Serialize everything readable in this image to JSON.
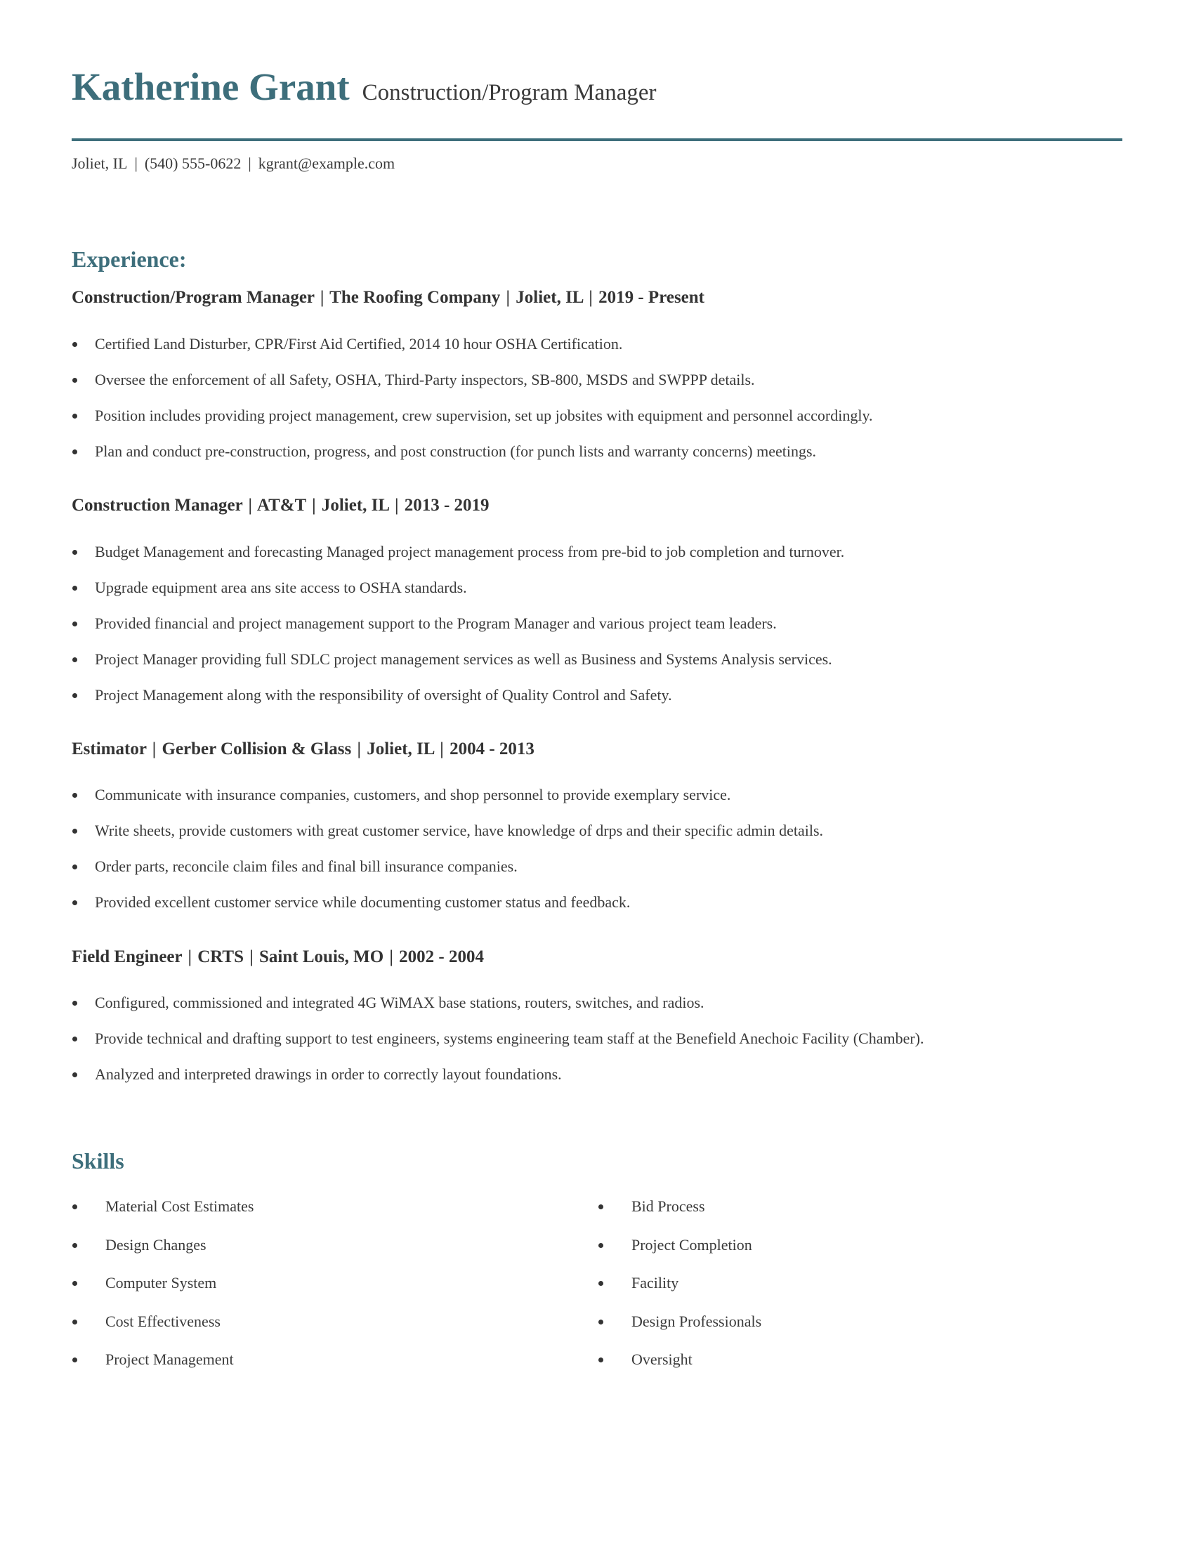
{
  "header": {
    "name": "Katherine Grant",
    "title": "Construction/Program Manager",
    "accent_color": "#3d6e7b"
  },
  "contact": {
    "location": "Joliet, IL",
    "phone": "(540) 555-0622",
    "email": "kgrant@example.com",
    "separator": "|"
  },
  "experience": {
    "heading": "Experience:",
    "jobs": [
      {
        "role": "Construction/Program Manager",
        "company": "The Roofing Company",
        "location": "Joliet, IL",
        "dates": "2019 - Present",
        "bullets": [
          "Certified Land Disturber, CPR/First Aid Certified, 2014 10 hour OSHA Certification.",
          "Oversee the enforcement of all Safety, OSHA, Third-Party inspectors, SB-800, MSDS and SWPPP details.",
          "Position includes providing project management, crew supervision, set up jobsites with equipment and personnel accordingly.",
          "Plan and conduct pre-construction, progress, and post construction (for punch lists and warranty concerns) meetings."
        ]
      },
      {
        "role": "Construction Manager",
        "company": "AT&T",
        "location": "Joliet, IL",
        "dates": "2013 - 2019",
        "bullets": [
          "Budget Management and forecasting Managed project management process from pre-bid to job completion and turnover.",
          "Upgrade equipment area ans site access to OSHA standards.",
          "Provided financial and project management support to the Program Manager and various project team leaders.",
          "Project Manager providing full SDLC project management services as well as Business and Systems Analysis services.",
          "Project Management along with the responsibility of oversight of Quality Control and Safety."
        ]
      },
      {
        "role": "Estimator",
        "company": "Gerber Collision & Glass",
        "location": "Joliet, IL",
        "dates": "2004 - 2013",
        "bullets": [
          "Communicate with insurance companies, customers, and shop personnel to provide exemplary service.",
          "Write sheets, provide customers with great customer service, have knowledge of drps and their specific admin details.",
          "Order parts, reconcile claim files and final bill insurance companies.",
          "Provided excellent customer service while documenting customer status and feedback."
        ]
      },
      {
        "role": "Field Engineer",
        "company": "CRTS",
        "location": "Saint Louis, MO",
        "dates": "2002 - 2004",
        "bullets": [
          "Configured, commissioned and integrated 4G WiMAX base stations, routers, switches, and radios.",
          "Provide technical and drafting support to test engineers, systems engineering team staff at the Benefield Anechoic Facility (Chamber).",
          "Analyzed and interpreted drawings in order to correctly layout foundations."
        ]
      }
    ]
  },
  "skills": {
    "heading": "Skills",
    "left": [
      "Material Cost Estimates",
      "Design Changes",
      "Computer System",
      "Cost Effectiveness",
      "Project Management"
    ],
    "right": [
      "Bid Process",
      "Project Completion",
      "Facility",
      "Design Professionals",
      "Oversight"
    ]
  }
}
